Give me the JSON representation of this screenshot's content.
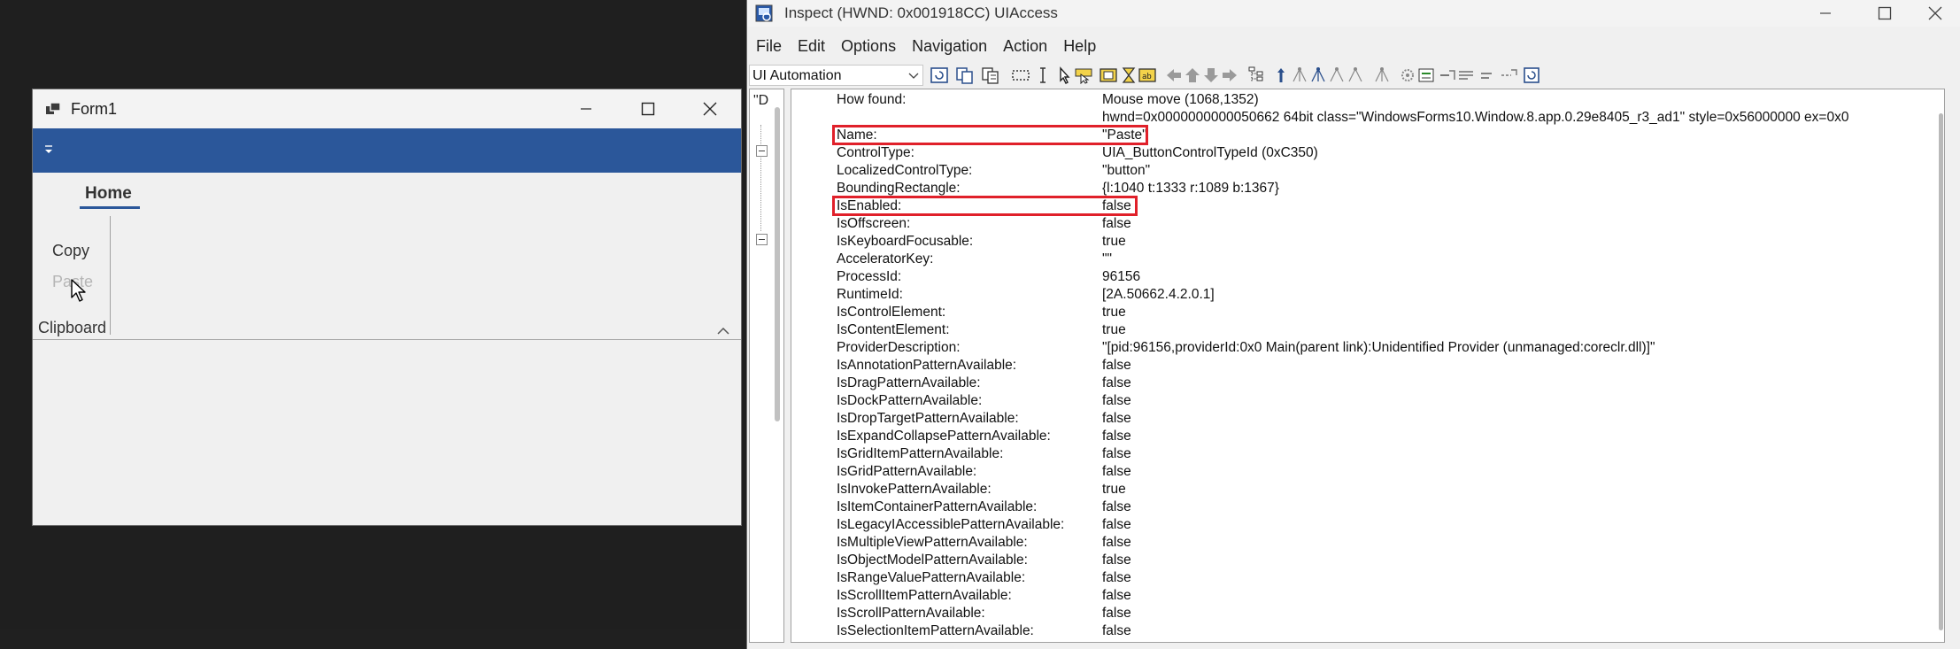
{
  "form1": {
    "title": "Form1",
    "tab_home": "Home",
    "copy_label": "Copy",
    "paste_label": "Paste",
    "group_label": "Clipboard",
    "ribbon_color": "#2b579a",
    "paste_enabled": false
  },
  "inspect": {
    "title": "Inspect  (HWND: 0x001918CC) UIAccess",
    "menu": [
      "File",
      "Edit",
      "Options",
      "Navigation",
      "Action",
      "Help"
    ],
    "mode_select": "UI Automation",
    "tree_text": "\"D",
    "highlight_color": "#e0202a",
    "properties": [
      {
        "name": "How found:",
        "value": "Mouse move (1068,1352)"
      },
      {
        "name": "",
        "value": "hwnd=0x0000000000050662 64bit class=\"WindowsForms10.Window.8.app.0.29e8405_r3_ad1\" style=0x56000000 ex=0x0"
      },
      {
        "name": "Name:",
        "value": "\"Paste\"",
        "highlight": true
      },
      {
        "name": "ControlType:",
        "value": "UIA_ButtonControlTypeId (0xC350)"
      },
      {
        "name": "LocalizedControlType:",
        "value": "\"button\""
      },
      {
        "name": "BoundingRectangle:",
        "value": "{l:1040 t:1333 r:1089 b:1367}"
      },
      {
        "name": "IsEnabled:",
        "value": "false",
        "highlight": true
      },
      {
        "name": "IsOffscreen:",
        "value": "false"
      },
      {
        "name": "IsKeyboardFocusable:",
        "value": "true"
      },
      {
        "name": "AcceleratorKey:",
        "value": "\"\""
      },
      {
        "name": "ProcessId:",
        "value": "96156"
      },
      {
        "name": "RuntimeId:",
        "value": "[2A.50662.4.2.0.1]"
      },
      {
        "name": "IsControlElement:",
        "value": "true"
      },
      {
        "name": "IsContentElement:",
        "value": "true"
      },
      {
        "name": "ProviderDescription:",
        "value": "\"[pid:96156,providerId:0x0 Main(parent link):Unidentified Provider (unmanaged:coreclr.dll)]\""
      },
      {
        "name": "IsAnnotationPatternAvailable:",
        "value": "false"
      },
      {
        "name": "IsDragPatternAvailable:",
        "value": "false"
      },
      {
        "name": "IsDockPatternAvailable:",
        "value": "false"
      },
      {
        "name": "IsDropTargetPatternAvailable:",
        "value": "false"
      },
      {
        "name": "IsExpandCollapsePatternAvailable:",
        "value": "false"
      },
      {
        "name": "IsGridItemPatternAvailable:",
        "value": "false"
      },
      {
        "name": "IsGridPatternAvailable:",
        "value": "false"
      },
      {
        "name": "IsInvokePatternAvailable:",
        "value": "true"
      },
      {
        "name": "IsItemContainerPatternAvailable:",
        "value": "false"
      },
      {
        "name": "IsLegacyIAccessiblePatternAvailable:",
        "value": "false"
      },
      {
        "name": "IsMultipleViewPatternAvailable:",
        "value": "false"
      },
      {
        "name": "IsObjectModelPatternAvailable:",
        "value": "false"
      },
      {
        "name": "IsRangeValuePatternAvailable:",
        "value": "false"
      },
      {
        "name": "IsScrollItemPatternAvailable:",
        "value": "false"
      },
      {
        "name": "IsScrollPatternAvailable:",
        "value": "false"
      },
      {
        "name": "IsSelectionItemPatternAvailable:",
        "value": "false"
      }
    ]
  }
}
